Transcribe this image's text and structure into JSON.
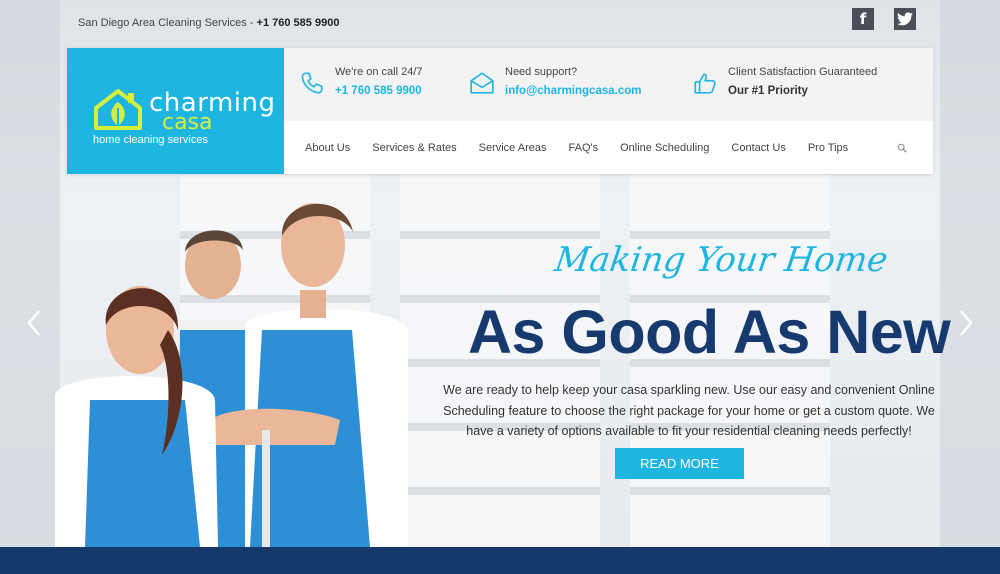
{
  "topbar": {
    "info_text": "San Diego Area Cleaning Services - ",
    "phone": "+1 760 585 9900"
  },
  "social": {
    "facebook_icon": "facebook-icon",
    "twitter_icon": "twitter-icon"
  },
  "logo": {
    "word1": "charming",
    "word2": "casa",
    "tagline": "home cleaning services"
  },
  "contacts": [
    {
      "line1": "We're on call 24/7",
      "line2": "+1 760 585 9900",
      "icon": "phone-icon"
    },
    {
      "line1": "Need support?",
      "line2": "info@charmingcasa.com",
      "icon": "envelope-icon"
    },
    {
      "line1": "Client Satisfaction Guaranteed",
      "line2": "Our #1 Priority",
      "icon": "thumbs-up-icon"
    }
  ],
  "nav": {
    "items": [
      "About Us",
      "Services & Rates",
      "Service Areas",
      "FAQ's",
      "Online Scheduling",
      "Contact Us",
      "Pro Tips"
    ]
  },
  "hero": {
    "script": "Making Your Home",
    "title": "As Good As New",
    "description": "We are ready to help keep your casa sparkling new. Use our easy and convenient Online Scheduling feature to choose the right package for your home or get a custom quote. We have a variety of options available to fit your residential cleaning needs perfectly!",
    "button": "READ MORE"
  },
  "colors": {
    "brand_blue": "#1eb6e1",
    "navy": "#173a6e",
    "logo_green": "#d6ef3e"
  }
}
